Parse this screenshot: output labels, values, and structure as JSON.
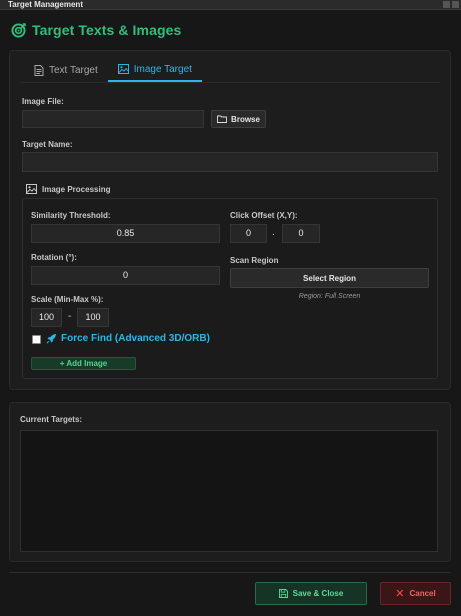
{
  "window": {
    "title": "Target Management"
  },
  "header": {
    "title": "Target Texts & Images",
    "icon": "target-icon"
  },
  "tabs": [
    {
      "label": "Text Target",
      "icon": "text-file-icon",
      "active": false
    },
    {
      "label": "Image Target",
      "icon": "image-icon",
      "active": true
    }
  ],
  "image_file": {
    "label": "Image File:",
    "value": "",
    "browse_label": "Browse"
  },
  "target_name": {
    "label": "Target Name:",
    "value": ""
  },
  "image_processing": {
    "title": "Image Processing",
    "similarity": {
      "label": "Similarity Threshold:",
      "value": "0.85"
    },
    "rotation": {
      "label": "Rotation (°):",
      "value": "0"
    },
    "scale": {
      "label": "Scale (Min-Max %):",
      "min": "100",
      "max": "100",
      "separator": "-"
    },
    "click_offset": {
      "label": "Click Offset (X,Y):",
      "x": "0",
      "y": "0",
      "separator": "."
    },
    "scan_region": {
      "label": "Scan Region",
      "button_label": "Select Region",
      "status": "Region: Full Screen"
    },
    "force_find": {
      "label": "Force Find (Advanced 3D/ORB)",
      "checked": false
    },
    "add_button_label": "+ Add Image"
  },
  "current_targets": {
    "label": "Current Targets:",
    "items": []
  },
  "footer": {
    "save_label": "Save & Close",
    "cancel_label": "Cancel"
  },
  "colors": {
    "accent_green": "#2fbf7a",
    "accent_blue": "#2ab6ea",
    "danger_red": "#ef6464",
    "background": "#171717"
  }
}
